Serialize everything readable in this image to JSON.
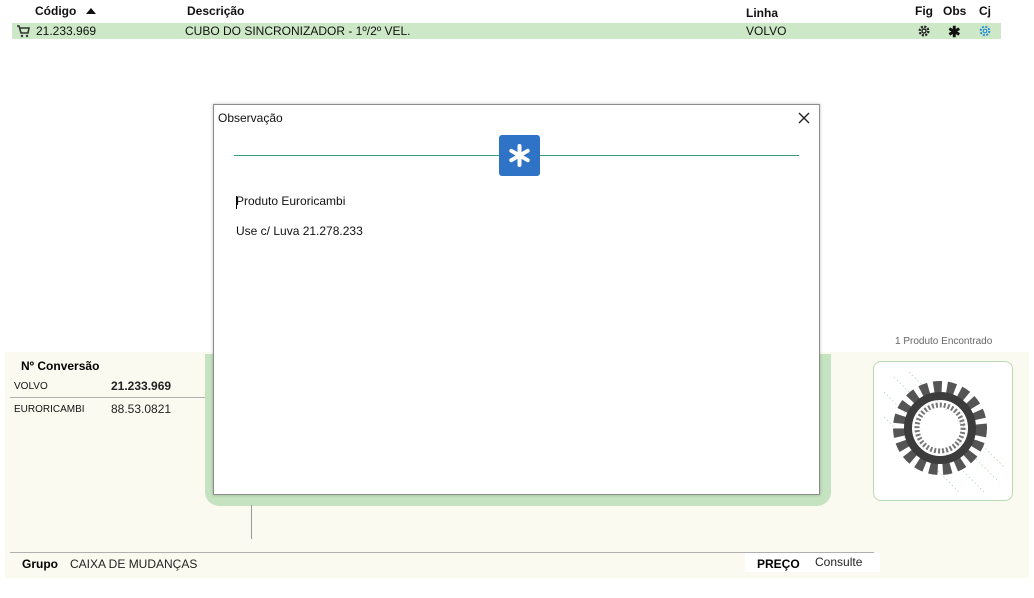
{
  "header": {
    "codigo": "Código",
    "descricao": "Descrição",
    "linha": "Linha",
    "fig": "Fig",
    "obs": "Obs",
    "cj": "Cj"
  },
  "row": {
    "codigo": "21.233.969",
    "descricao": "CUBO DO SINCRONIZADOR - 1º/2º VEL.",
    "linha": "VOLVO",
    "icons": [
      "cart-icon",
      "gear-icon",
      "asterisk-icon",
      "gear-outline-icon"
    ]
  },
  "conversao": {
    "title": "Nº Conversão",
    "items": [
      {
        "brand": "VOLVO",
        "code": "21.233.969"
      },
      {
        "brand": "EURORICAMBI",
        "code": "88.53.0821"
      }
    ]
  },
  "results": {
    "found": "1 Produto Encontrado"
  },
  "footer": {
    "grupo_label": "Grupo",
    "grupo_value": "CAIXA DE MUDANÇAS",
    "preco_label": "PREÇO",
    "preco_value": "Consulte"
  },
  "dialog": {
    "title": "Observação",
    "line1": "Produto Euroricambi",
    "line2": "Use c/ Luva 21.278.233"
  },
  "colors": {
    "row_highlight": "#cde8c7",
    "badge_blue": "#2f73c7",
    "divider_green": "#3a9a7c",
    "cj_icon_blue": "#2a8fd6"
  }
}
